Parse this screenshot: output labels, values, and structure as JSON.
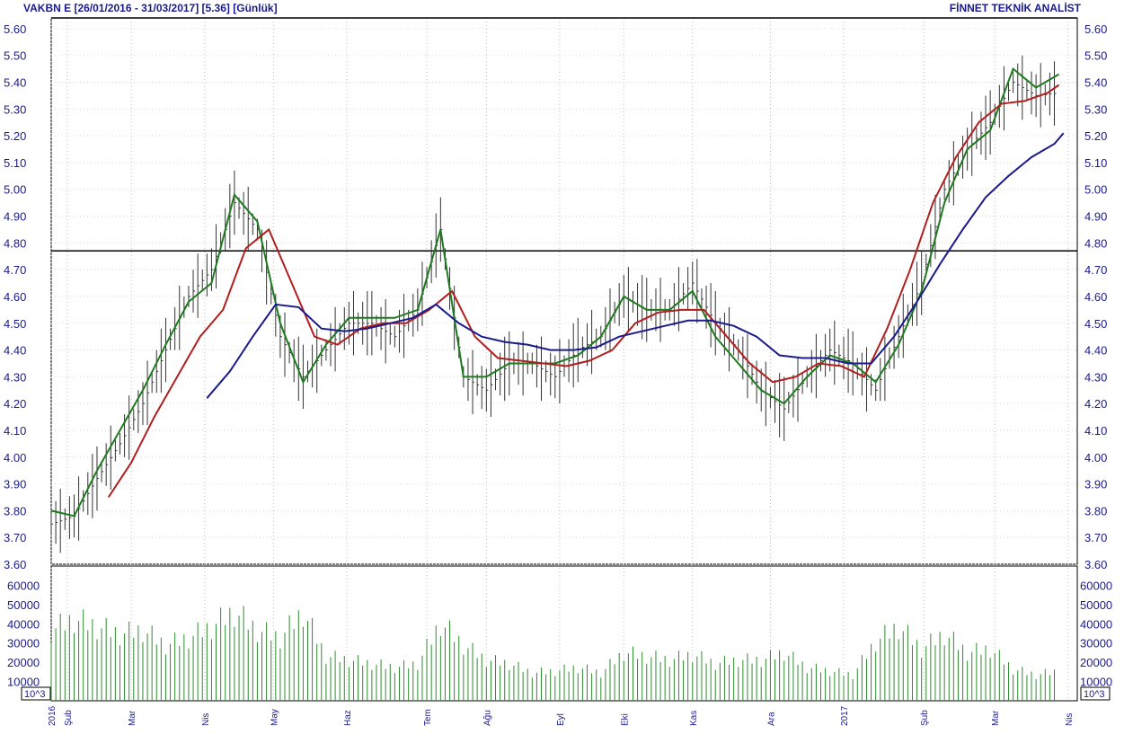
{
  "header": {
    "title": "VAKBN E  [26/01/2016 - 31/03/2017]  [5.36]  [Günlük]",
    "brand": "FİNNET TEKNİK ANALİST"
  },
  "volume_unit": "10^3",
  "chart_data": [
    {
      "type": "line",
      "panel": "price",
      "title": "VAKBN E  [26/01/2016 - 31/03/2017]  [5.36]  [Günlük]",
      "ylim": [
        3.6,
        5.64
      ],
      "yticks": [
        "5.60",
        "5.50",
        "5.40",
        "5.30",
        "5.20",
        "5.10",
        "5.00",
        "4.90",
        "4.80",
        "4.70",
        "4.60",
        "4.50",
        "4.40",
        "4.30",
        "4.20",
        "4.10",
        "4.00",
        "3.90",
        "3.80",
        "3.70",
        "3.60"
      ],
      "x_ticks": [
        "2016",
        "Şub",
        "Mar",
        "Nis",
        "May",
        "Haz",
        "Tem",
        "Ağu",
        "Eyl",
        "Eki",
        "Kas",
        "Ara",
        "2017",
        "Şub",
        "Mar",
        "Nis"
      ],
      "x_tick_days": [
        0,
        7,
        35,
        67,
        97,
        129,
        164,
        190,
        222,
        250,
        280,
        314,
        346,
        381,
        412,
        444
      ],
      "horizontal_lines": [
        5.64,
        4.77
      ],
      "grid": true,
      "series": [
        {
          "key": "close",
          "color": "#1a1a1a",
          "x": [
            0,
            10,
            20,
            30,
            40,
            50,
            60,
            70,
            80,
            90,
            100,
            110,
            120,
            130,
            140,
            150,
            160,
            170,
            180,
            190,
            200,
            210,
            220,
            230,
            240,
            250,
            260,
            270,
            280,
            290,
            300,
            310,
            320,
            330,
            340,
            350,
            360,
            370,
            380,
            390,
            400,
            410,
            420,
            430,
            440
          ],
          "values": [
            3.75,
            3.78,
            3.92,
            4.05,
            4.2,
            4.4,
            4.6,
            4.7,
            4.95,
            4.85,
            4.45,
            4.3,
            4.4,
            4.5,
            4.5,
            4.45,
            4.55,
            4.85,
            4.3,
            4.25,
            4.35,
            4.35,
            4.3,
            4.4,
            4.45,
            4.6,
            4.55,
            4.55,
            4.65,
            4.5,
            4.4,
            4.25,
            4.18,
            4.3,
            4.4,
            4.35,
            4.25,
            4.45,
            4.65,
            5.0,
            5.15,
            5.25,
            5.4,
            5.35,
            5.36
          ]
        },
        {
          "key": "ma-short",
          "color": "#1f7a1f",
          "x": [
            0,
            10,
            20,
            30,
            40,
            50,
            60,
            70,
            80,
            90,
            100,
            110,
            120,
            130,
            140,
            150,
            160,
            170,
            180,
            190,
            200,
            210,
            220,
            230,
            240,
            250,
            260,
            270,
            280,
            290,
            300,
            310,
            320,
            330,
            340,
            350,
            360,
            370,
            380,
            390,
            400,
            410,
            420,
            430,
            440
          ],
          "values": [
            3.8,
            3.78,
            3.95,
            4.1,
            4.25,
            4.42,
            4.58,
            4.65,
            4.98,
            4.88,
            4.5,
            4.28,
            4.42,
            4.52,
            4.52,
            4.52,
            4.55,
            4.85,
            4.3,
            4.3,
            4.35,
            4.35,
            4.35,
            4.38,
            4.45,
            4.6,
            4.55,
            4.55,
            4.62,
            4.45,
            4.35,
            4.25,
            4.2,
            4.3,
            4.38,
            4.35,
            4.28,
            4.42,
            4.62,
            4.95,
            5.15,
            5.22,
            5.45,
            5.38,
            5.43
          ]
        },
        {
          "key": "ma-mid",
          "color": "#b01e1e",
          "x": [
            25,
            35,
            45,
            55,
            65,
            75,
            85,
            95,
            105,
            115,
            125,
            135,
            145,
            155,
            165,
            175,
            185,
            195,
            205,
            215,
            225,
            235,
            245,
            255,
            265,
            275,
            285,
            295,
            305,
            315,
            325,
            335,
            345,
            355,
            365,
            375,
            385,
            395,
            405,
            415,
            425,
            435,
            440
          ],
          "values": [
            3.85,
            3.98,
            4.15,
            4.3,
            4.45,
            4.55,
            4.78,
            4.85,
            4.65,
            4.45,
            4.42,
            4.48,
            4.5,
            4.5,
            4.55,
            4.62,
            4.45,
            4.37,
            4.36,
            4.35,
            4.34,
            4.36,
            4.4,
            4.5,
            4.54,
            4.55,
            4.55,
            4.45,
            4.35,
            4.28,
            4.3,
            4.35,
            4.34,
            4.3,
            4.48,
            4.7,
            4.95,
            5.12,
            5.25,
            5.32,
            5.33,
            5.36,
            5.39
          ]
        },
        {
          "key": "ma-long",
          "color": "#1a1a8c",
          "x": [
            68,
            78,
            88,
            98,
            108,
            118,
            128,
            138,
            148,
            158,
            168,
            178,
            188,
            198,
            208,
            218,
            228,
            238,
            248,
            258,
            268,
            278,
            288,
            298,
            308,
            318,
            328,
            338,
            348,
            358,
            368,
            378,
            388,
            398,
            408,
            418,
            428,
            438,
            442
          ],
          "values": [
            4.22,
            4.32,
            4.45,
            4.57,
            4.56,
            4.48,
            4.47,
            4.48,
            4.5,
            4.52,
            4.57,
            4.5,
            4.45,
            4.43,
            4.42,
            4.4,
            4.4,
            4.41,
            4.45,
            4.47,
            4.49,
            4.51,
            4.51,
            4.49,
            4.45,
            4.38,
            4.37,
            4.37,
            4.35,
            4.35,
            4.45,
            4.58,
            4.72,
            4.85,
            4.97,
            5.05,
            5.12,
            5.17,
            5.21
          ]
        }
      ]
    },
    {
      "type": "bar",
      "panel": "volume",
      "ylim": [
        0,
        70000
      ],
      "yticks": [
        "60000",
        "50000",
        "40000",
        "30000",
        "20000",
        "10000"
      ],
      "x": [
        0,
        10,
        20,
        30,
        40,
        50,
        60,
        70,
        80,
        90,
        100,
        110,
        120,
        130,
        140,
        150,
        160,
        170,
        180,
        190,
        200,
        210,
        220,
        230,
        240,
        250,
        260,
        270,
        280,
        290,
        300,
        310,
        320,
        330,
        340,
        350,
        360,
        370,
        380,
        390,
        400,
        410,
        420,
        430,
        440
      ],
      "values": [
        38000,
        44000,
        40000,
        36000,
        38000,
        30000,
        34000,
        40000,
        48000,
        38000,
        34000,
        48000,
        24000,
        22000,
        20000,
        18000,
        20000,
        42000,
        30000,
        22000,
        20000,
        15000,
        16000,
        18000,
        15000,
        26000,
        24000,
        22000,
        25000,
        20000,
        22000,
        22000,
        26000,
        18000,
        16000,
        14000,
        32000,
        40000,
        28000,
        36000,
        26000,
        28000,
        17000,
        14000,
        16000
      ]
    }
  ]
}
